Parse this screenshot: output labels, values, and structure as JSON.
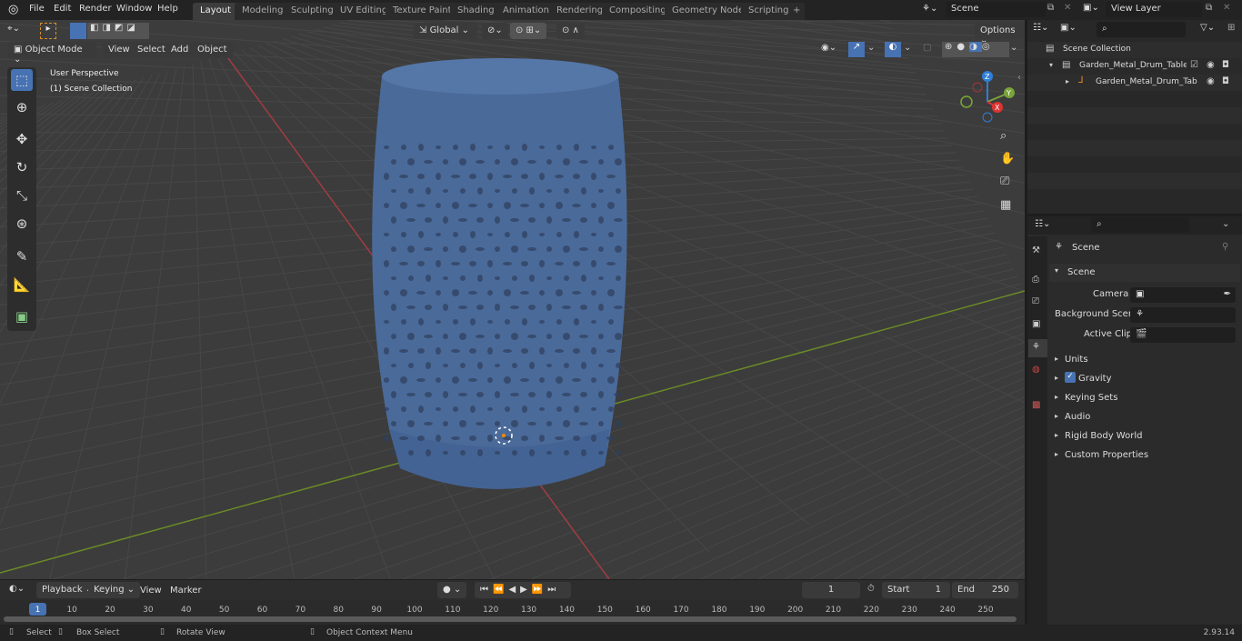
{
  "topbar": {
    "menus": [
      "File",
      "Edit",
      "Render",
      "Window",
      "Help"
    ],
    "workspaces": [
      "Layout",
      "Modeling",
      "Sculpting",
      "UV Editing",
      "Texture Paint",
      "Shading",
      "Animation",
      "Rendering",
      "Compositing",
      "Geometry Nodes",
      "Scripting"
    ],
    "active_workspace": "Layout",
    "scene": "Scene",
    "view_layer": "View Layer"
  },
  "viewport": {
    "mode": "Object Mode",
    "menus": [
      "View",
      "Select",
      "Add",
      "Object"
    ],
    "orientation": "Global",
    "options": "Options",
    "overlay_text": [
      "User Perspective",
      "(1) Scene Collection"
    ],
    "gizmo_axes": [
      "Z",
      "Y",
      "X"
    ],
    "tools": [
      "select-box-icon",
      "cursor-icon",
      "move-icon",
      "rotate-icon",
      "scale-icon",
      "transform-icon",
      "annotate-icon",
      "measure-icon",
      "add-cube-icon"
    ],
    "nav_icons": [
      "zoom-icon",
      "pan-hand-icon",
      "camera-icon",
      "grid-icon"
    ],
    "object_color": "#4a6a9a"
  },
  "outliner": {
    "root": "Scene Collection",
    "items": [
      {
        "label": "Garden_Metal_Drum_Table_B",
        "type": "collection"
      },
      {
        "label": "Garden_Metal_Drum_Tab",
        "type": "object"
      }
    ]
  },
  "properties": {
    "header": "Scene",
    "section": "Scene",
    "fields": [
      {
        "label": "Camera",
        "value": ""
      },
      {
        "label": "Background Scene",
        "value": ""
      },
      {
        "label": "Active Clip",
        "value": ""
      }
    ],
    "panels": [
      "Units",
      "Gravity",
      "Keying Sets",
      "Audio",
      "Rigid Body World",
      "Custom Properties"
    ],
    "gravity_checked": true
  },
  "timeline": {
    "menus": [
      "Playback",
      "Keying",
      "View",
      "Marker"
    ],
    "current_frame": "1",
    "start_label": "Start",
    "start": "1",
    "end_label": "End",
    "end": "250",
    "ticks": [
      "1",
      "10",
      "20",
      "30",
      "40",
      "50",
      "60",
      "70",
      "80",
      "90",
      "100",
      "110",
      "120",
      "130",
      "140",
      "150",
      "160",
      "170",
      "180",
      "190",
      "200",
      "210",
      "220",
      "230",
      "240",
      "250"
    ]
  },
  "status": {
    "hints": [
      "Select",
      "Box Select",
      "Rotate View",
      "Object Context Menu"
    ],
    "version": "2.93.14"
  }
}
